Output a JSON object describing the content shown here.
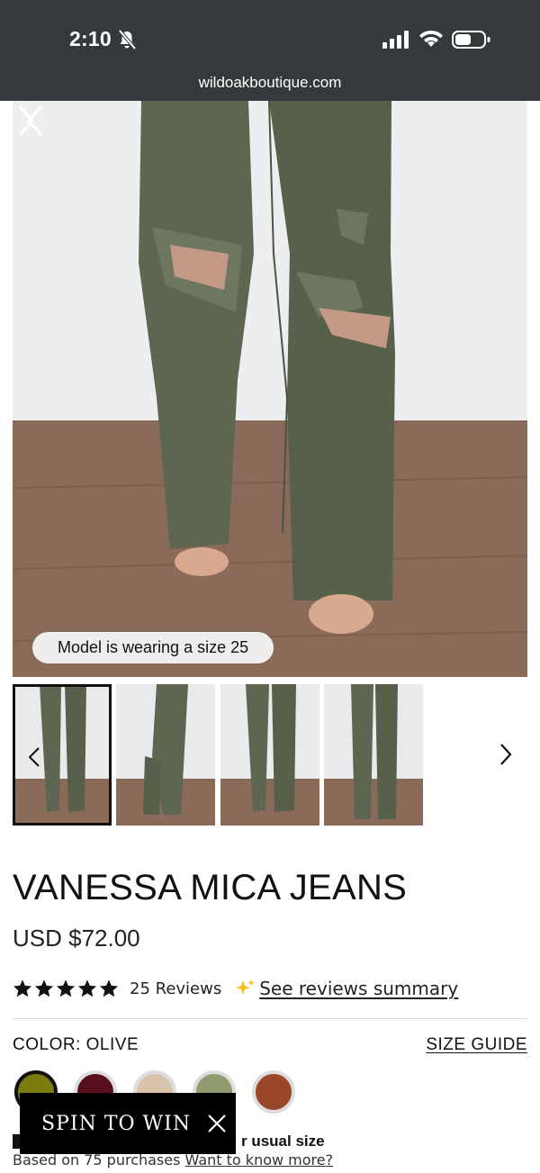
{
  "status_bar": {
    "time": "2:10",
    "url": "wildoakboutique.com"
  },
  "hero": {
    "model_note": "Model is wearing a size 25"
  },
  "product": {
    "title": "VANESSA MICA JEANS",
    "price": "USD $72.00",
    "rating": 5,
    "review_count": "25 Reviews",
    "summary_link": "See reviews summary",
    "color_label": "COLOR:",
    "color_value": "OLIVE",
    "size_guide": "SIZE GUIDE",
    "swatches": [
      "#7a7d0e",
      "#5a0f1f",
      "#d8c4ad",
      "#8e9b6d",
      "#9a4628"
    ],
    "fit_text": "r usual size",
    "based_on": "Based on 75 purchases",
    "know_more": "Want to know more?"
  },
  "promo": {
    "label": "SPIN TO WIN"
  },
  "colors": {
    "status_bar_bg": "#34393b",
    "jeans_olive": "#5c6650",
    "floor_wood": "#8a6b59"
  }
}
